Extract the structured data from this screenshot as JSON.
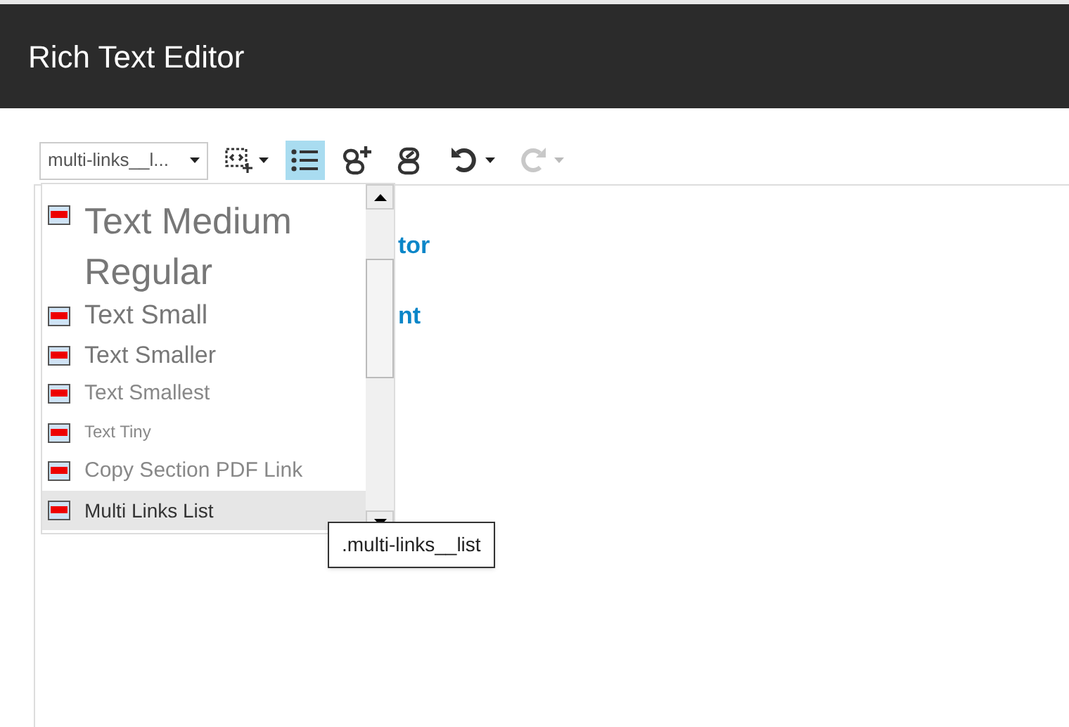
{
  "window": {
    "title": "Rich Text Editor"
  },
  "toolbar": {
    "style_select": {
      "value": "multi-links__l..."
    },
    "buttons": [
      {
        "kind": "snippet",
        "selected": false,
        "disabled": false,
        "has_menu": true
      },
      {
        "kind": "bullets",
        "selected": true,
        "disabled": false,
        "has_menu": false
      },
      {
        "kind": "link",
        "selected": false,
        "disabled": false,
        "has_menu": false
      },
      {
        "kind": "unlink",
        "selected": false,
        "disabled": false,
        "has_menu": false
      },
      {
        "kind": "undo",
        "selected": false,
        "disabled": false,
        "has_menu": true
      },
      {
        "kind": "redo",
        "selected": false,
        "disabled": true,
        "has_menu": true
      }
    ]
  },
  "editor": {
    "lines": [
      "tor",
      "nt"
    ]
  },
  "style_menu": {
    "items": [
      {
        "label": "Text Medium Regular",
        "selected": false
      },
      {
        "label": "Text Small",
        "selected": false
      },
      {
        "label": "Text Smaller",
        "selected": false
      },
      {
        "label": "Text Smallest",
        "selected": false
      },
      {
        "label": "Text Tiny",
        "selected": false
      },
      {
        "label": "Copy Section PDF Link",
        "selected": false
      },
      {
        "label": "Multi Links List",
        "selected": true
      }
    ]
  },
  "tooltip": {
    "text": ".multi-links__list"
  }
}
